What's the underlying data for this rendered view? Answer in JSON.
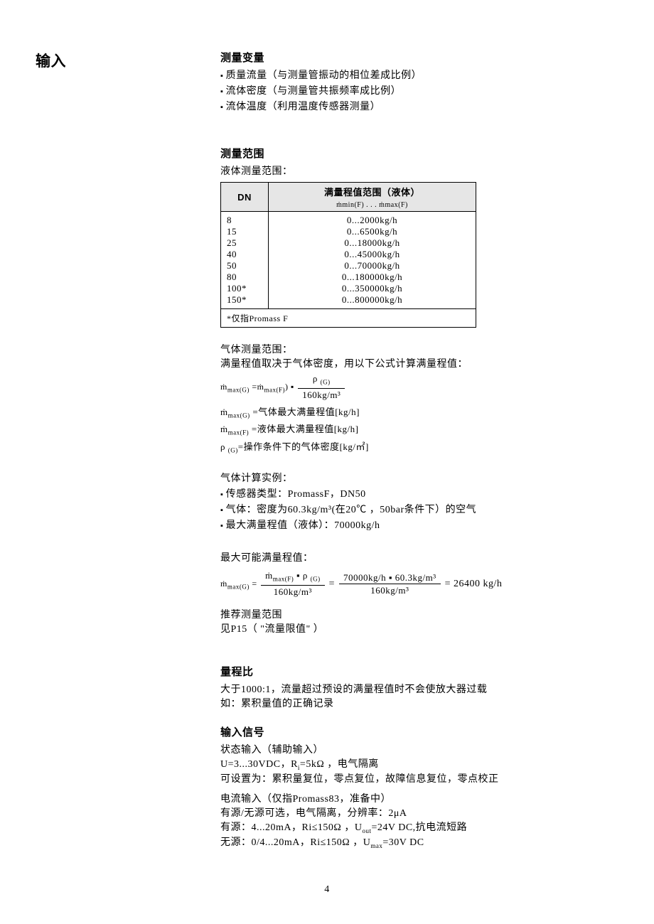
{
  "side_title": "输入",
  "s1": {
    "title": "测量变量",
    "items": [
      "质量流量（与测量管振动的相位差成比例）",
      "流体密度（与测量管共振频率成比例）",
      "流体温度（利用温度传感器测量）"
    ]
  },
  "s2": {
    "title": "测量范围",
    "liquid_label": "液体测量范围：",
    "table": {
      "h_dn": "DN",
      "h_range": "满量程值范围（液体）",
      "h_range_sub": "ṁmin(F) . . . ṁmax(F)",
      "rows": [
        {
          "dn": "8",
          "val": "0...2000kg/h"
        },
        {
          "dn": "15",
          "val": "0...6500kg/h"
        },
        {
          "dn": "25",
          "val": "0...18000kg/h"
        },
        {
          "dn": "40",
          "val": "0...45000kg/h"
        },
        {
          "dn": "50",
          "val": "0...70000kg/h"
        },
        {
          "dn": "80",
          "val": "0...180000kg/h"
        },
        {
          "dn": "100*",
          "val": "0...350000kg/h"
        },
        {
          "dn": "150*",
          "val": "0...800000kg/h"
        }
      ],
      "note": "*仅指Promass F"
    },
    "gas_label": "气体测量范围：",
    "gas_desc": "满量程值取决于气体密度，用以下公式计算满量程值：",
    "formula_main_left": "ṁmax(G) =ṁmax(F) ▪",
    "formula_main_num": "ρ(G)",
    "formula_main_den": "160kg/m³",
    "leg": [
      "ṁmax(G) =气体最大满量程值[kg/h]",
      "ṁmax(F) =液体最大满量程值[kg/h]",
      "ρ(G)=操作条件下的气体密度[kg/㎡]"
    ],
    "ex_title": "气体计算实例：",
    "ex_items": [
      "传感器类型：PromassF，DN50",
      "气体：密度为60.3kg/m³(在20℃ ，50bar条件下）的空气",
      "最大满量程值（液体）：70000kg/h"
    ],
    "max_label": "最大可能满量程值：",
    "max_formula_left": "ṁmax(G) =",
    "max_frac1_num": "ṁmax(F) ▪ ρ(G)",
    "max_frac1_den": "160kg/m³",
    "max_eq": "=",
    "max_frac2_num": "70000kg/h ▪ 60.3kg/m³",
    "max_frac2_den": "160kg/m³",
    "max_result": "= 26400 kg/h",
    "rec_label": "推荐测量范围",
    "rec_ref": "见P15（ \"流量限值\" ）"
  },
  "s3": {
    "title": "量程比",
    "l1": "大于1000:1，流量超过预设的满量程值时不会使放大器过载",
    "l2": "如：累积量值的正确记录"
  },
  "s4": {
    "title": "输入信号",
    "l1": "状态输入（辅助输入）",
    "l2": "U=3...30VDC，Ri=5kΩ ，电气隔离",
    "l3": "可设置为：累积量复位，零点复位，故障信息复位，零点校正",
    "l4": "电流输入（仅指Promass83，准备中）",
    "l5": "有源/无源可选，电气隔离，分辨率：2μA",
    "l6": "有源：4...20mA，Ri≤150Ω ，Uout=24V DC,抗电流短路",
    "l7": "无源：0/4...20mA，Ri≤150Ω ，Umax=30V DC"
  },
  "page_num": "4"
}
